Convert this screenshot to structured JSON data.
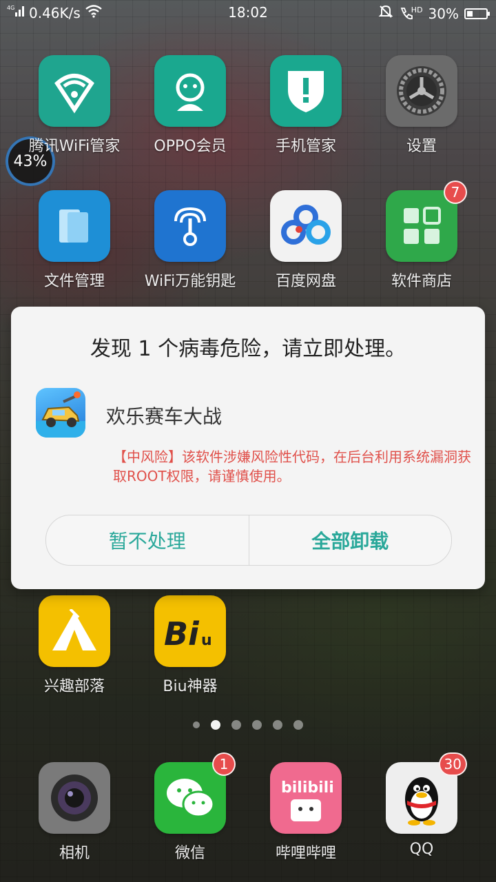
{
  "status_bar": {
    "network": "4G",
    "speed": "0.46K/s",
    "time": "18:02",
    "hd": "HD",
    "battery": "30%",
    "battery_fraction": 0.3
  },
  "speed_widget": "43%",
  "apps": [
    {
      "label": "腾讯WiFi管家",
      "icon": "tencent-wifi-icon",
      "color": "#1fa58f"
    },
    {
      "label": "OPPO会员",
      "icon": "oppo-member-icon",
      "color": "#1aa88f"
    },
    {
      "label": "手机管家",
      "icon": "shield-icon",
      "color": "#1aa88f"
    },
    {
      "label": "设置",
      "icon": "gear-icon",
      "color": "#6b6b6b"
    },
    {
      "label": "文件管理",
      "icon": "folder-icon",
      "color": "#1e8fd6"
    },
    {
      "label": "WiFi万能钥匙",
      "icon": "wifi-key-icon",
      "color": "#1f74d0"
    },
    {
      "label": "百度网盘",
      "icon": "baidu-cloud-icon",
      "color": "#f2f2f2"
    },
    {
      "label": "软件商店",
      "icon": "app-store-icon",
      "color": "#2fa84a",
      "badge": "7"
    },
    {
      "label": "兴趣部落",
      "icon": "tent-icon",
      "color": "#f4c000"
    },
    {
      "label": "Biu神器",
      "icon": "biu-icon",
      "color": "#f4c000"
    },
    {
      "label": "相机",
      "icon": "camera-icon",
      "color": "#7a7a7a"
    },
    {
      "label": "微信",
      "icon": "wechat-icon",
      "color": "#2ab53c",
      "badge": "1"
    },
    {
      "label": "哔哩哔哩",
      "icon": "bilibili-icon",
      "color": "#f06a8f"
    },
    {
      "label": "QQ",
      "icon": "qq-penguin-icon",
      "color": "#eeeeee",
      "badge": "30"
    }
  ],
  "dialog": {
    "title": "发现 1 个病毒危险，请立即处理。",
    "app_name": "欢乐赛车大战",
    "warning": "【中风险】该软件涉嫌风险性代码，在后台利用系统漏洞获取ROOT权限，请谨慎使用。",
    "btn_later": "暂不处理",
    "btn_uninstall": "全部卸载"
  }
}
